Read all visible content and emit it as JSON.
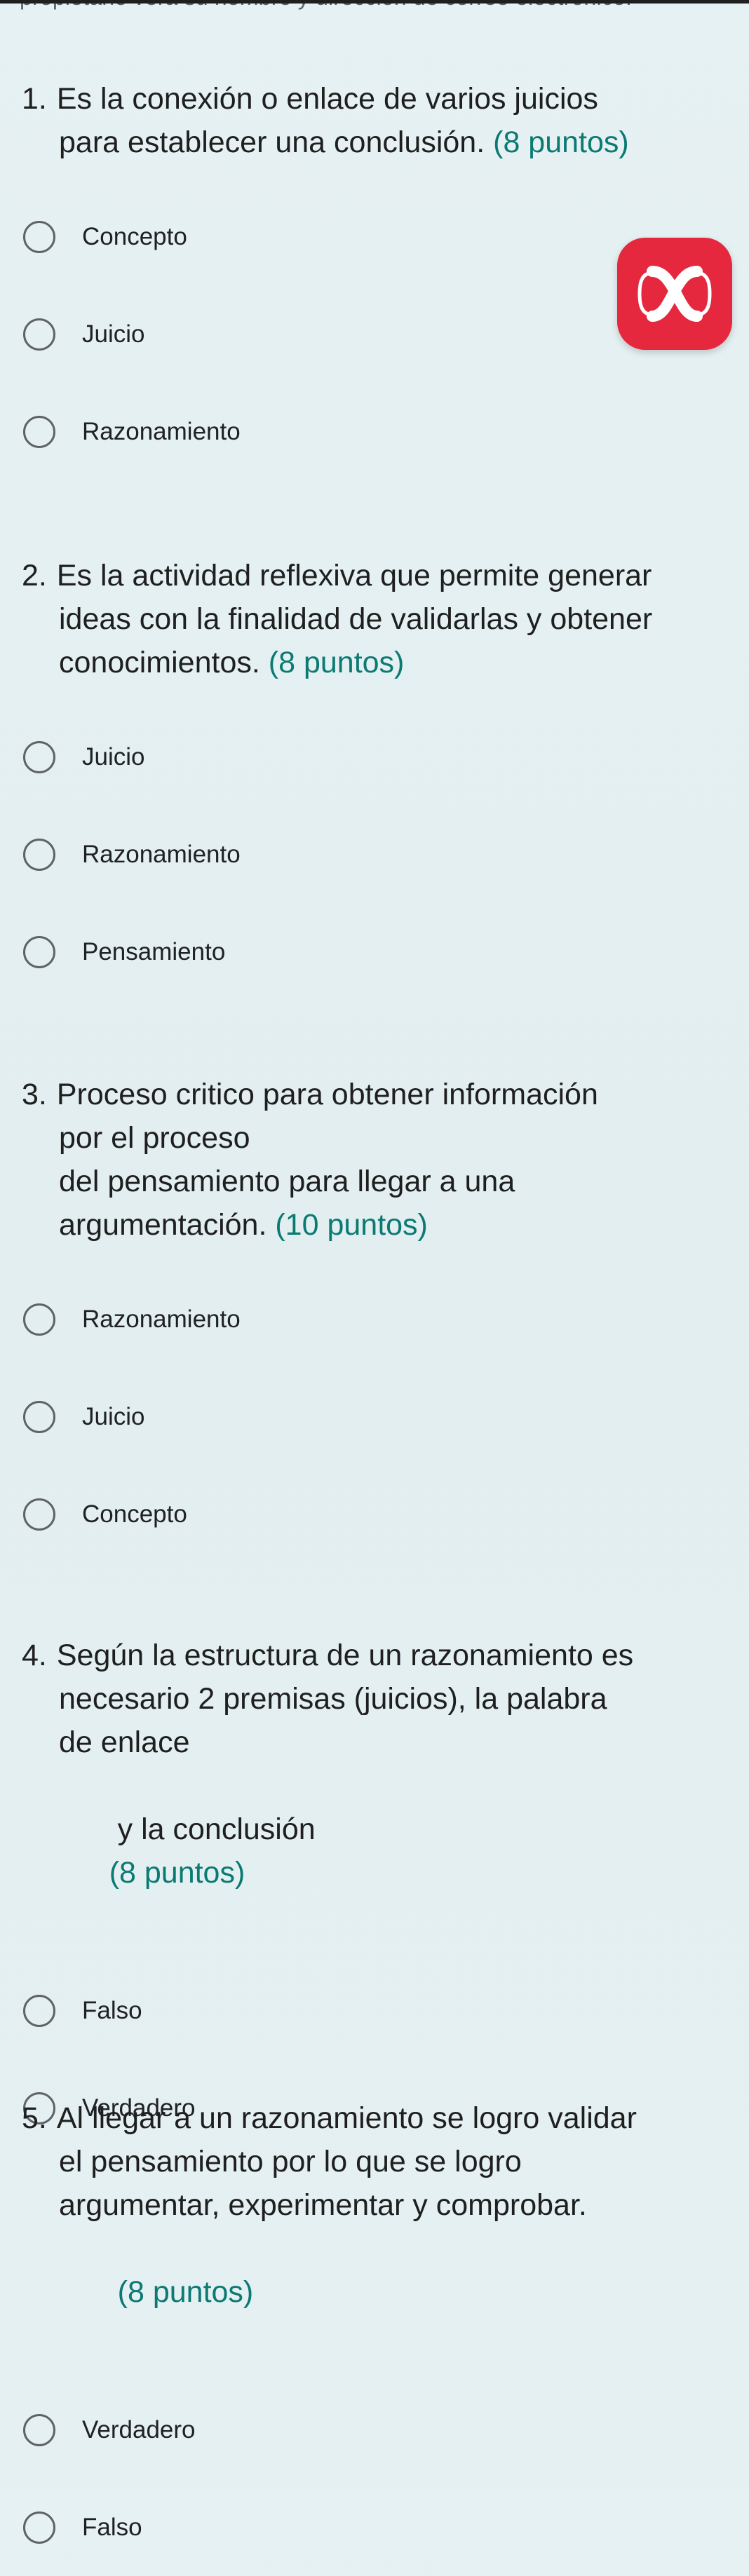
{
  "top_text": "propietario verá su nombre y dirección de correo electrónico.",
  "floating_button": {
    "icon": "x-logo-icon"
  },
  "questions": [
    {
      "number": "1.",
      "lines": [
        "Es la conexión o enlace de varios juicios",
        "para establecer una conclusión."
      ],
      "points": "(8 puntos)",
      "options": [
        "Concepto",
        "Juicio",
        "Razonamiento"
      ]
    },
    {
      "number": "2.",
      "lines": [
        "Es la actividad reflexiva que permite generar",
        "ideas con la finalidad de validarlas y obtener",
        "conocimientos."
      ],
      "points": "(8 puntos)",
      "options": [
        "Juicio",
        "Razonamiento",
        "Pensamiento"
      ]
    },
    {
      "number": "3.",
      "lines": [
        "Proceso critico para obtener información",
        "por el proceso",
        "del pensamiento para llegar a una",
        "argumentación."
      ],
      "points": "(10 puntos)",
      "options": [
        "Razonamiento",
        "Juicio",
        "Concepto"
      ]
    },
    {
      "number": "4.",
      "lines": [
        "Según la estructura de un razonamiento es",
        "necesario 2 premisas  (juicios), la palabra",
        "de enlace",
        " y la conclusión"
      ],
      "points": "(8 puntos)",
      "options": [
        "Falso",
        "Verdadero"
      ]
    },
    {
      "number": "5.",
      "lines": [
        "Al llegar a un razonamiento se logro validar",
        "el pensamiento por lo que se logro",
        "argumentar, experimentar y comprobar.",
        " "
      ],
      "points": "(8 puntos)",
      "options": [
        "Verdadero",
        "Falso"
      ]
    }
  ]
}
